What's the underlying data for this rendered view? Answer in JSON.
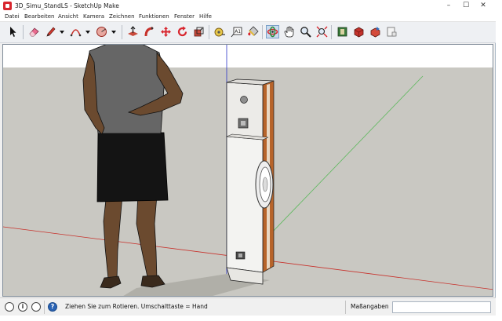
{
  "window": {
    "title": "3D_Simu_StandLS - SketchUp Make",
    "controls": {
      "minimize": "–",
      "maximize": "☐",
      "close": "✕"
    }
  },
  "menubar": {
    "items": [
      "Datei",
      "Bearbeiten",
      "Ansicht",
      "Kamera",
      "Zeichnen",
      "Funktionen",
      "Fenster",
      "Hilfe"
    ]
  },
  "toolbar": {
    "tools": [
      {
        "icon": "select-icon"
      },
      {
        "icon": "eraser-icon"
      },
      {
        "icon": "pencil-line-icon"
      },
      {
        "icon": "arc-icon"
      },
      {
        "icon": "shape-icon"
      },
      {
        "icon": "push-pull-icon"
      },
      {
        "icon": "follow-me-icon"
      },
      {
        "icon": "move-icon"
      },
      {
        "icon": "rotate-icon"
      },
      {
        "icon": "scale-icon"
      },
      {
        "icon": "tape-measure-icon"
      },
      {
        "icon": "text-icon"
      },
      {
        "icon": "paint-bucket-icon"
      },
      {
        "icon": "orbit-icon",
        "active": true
      },
      {
        "icon": "pan-icon"
      },
      {
        "icon": "zoom-icon"
      },
      {
        "icon": "zoom-extents-icon"
      },
      {
        "icon": "3d-warehouse-icon"
      },
      {
        "icon": "extension-warehouse-icon"
      },
      {
        "icon": "share-model-icon"
      },
      {
        "icon": "layout-icon"
      }
    ]
  },
  "statusbar": {
    "icons": [
      "geo-location-icon",
      "credits-icon",
      "user-icon",
      "help-icon"
    ],
    "help_glyph": "?",
    "info_glyph": "i",
    "status_text": "Ziehen Sie zum Rotieren.  Umschalttaste = Hand",
    "measurements_label": "Maßangaben",
    "measurements_value": ""
  },
  "colors": {
    "viewport_ground": "#c9c8c2",
    "viewport_sky": "#ffffff",
    "axis_red": "#c8312b",
    "axis_green": "#5cb85c",
    "axis_blue": "#2c35c8",
    "accent_orange": "#b7642a",
    "active_tool": "#c9dbee"
  }
}
